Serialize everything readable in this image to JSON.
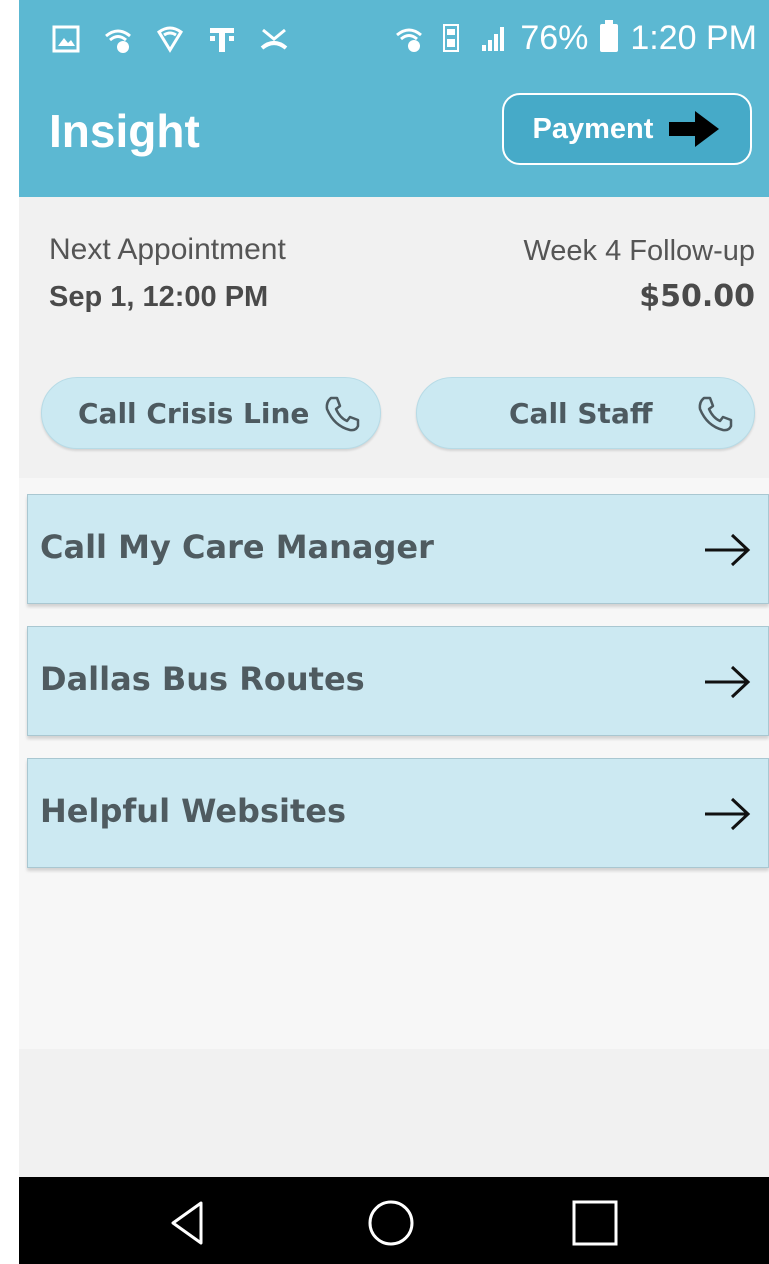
{
  "status_bar": {
    "battery": "76%",
    "time": "1:20 PM",
    "left_icons": [
      "image-icon",
      "wifi-call-icon",
      "shield-icon",
      "carrier-t-icon",
      "missed-call-icon"
    ],
    "right_icons": [
      "wifi-icon",
      "data-4g-icon",
      "signal-icon",
      "battery-icon"
    ]
  },
  "header": {
    "title": "Insight",
    "payment_label": "Payment"
  },
  "appointment": {
    "label": "Next Appointment",
    "date": "Sep 1, 12:00 PM",
    "type": "Week 4 Follow-up",
    "price": "$50.00"
  },
  "quick_actions": {
    "crisis_label": "Call Crisis Line",
    "staff_label": "Call Staff"
  },
  "menu": {
    "items": [
      {
        "label": "Call My Care Manager"
      },
      {
        "label": "Dallas Bus Routes"
      },
      {
        "label": "Helpful Websites"
      }
    ]
  },
  "colors": {
    "header": "#5cb8d2",
    "tile": "#cce9f2",
    "nav_bar": "#000000"
  }
}
